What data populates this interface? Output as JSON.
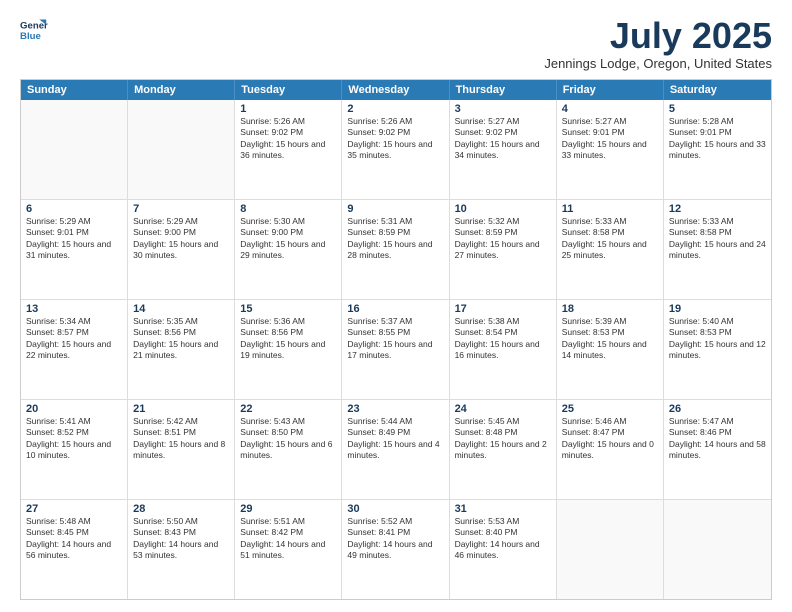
{
  "header": {
    "logo_line1": "General",
    "logo_line2": "Blue",
    "month": "July 2025",
    "location": "Jennings Lodge, Oregon, United States"
  },
  "weekdays": [
    "Sunday",
    "Monday",
    "Tuesday",
    "Wednesday",
    "Thursday",
    "Friday",
    "Saturday"
  ],
  "rows": [
    [
      {
        "day": "",
        "sunrise": "",
        "sunset": "",
        "daylight": ""
      },
      {
        "day": "",
        "sunrise": "",
        "sunset": "",
        "daylight": ""
      },
      {
        "day": "1",
        "sunrise": "Sunrise: 5:26 AM",
        "sunset": "Sunset: 9:02 PM",
        "daylight": "Daylight: 15 hours and 36 minutes."
      },
      {
        "day": "2",
        "sunrise": "Sunrise: 5:26 AM",
        "sunset": "Sunset: 9:02 PM",
        "daylight": "Daylight: 15 hours and 35 minutes."
      },
      {
        "day": "3",
        "sunrise": "Sunrise: 5:27 AM",
        "sunset": "Sunset: 9:02 PM",
        "daylight": "Daylight: 15 hours and 34 minutes."
      },
      {
        "day": "4",
        "sunrise": "Sunrise: 5:27 AM",
        "sunset": "Sunset: 9:01 PM",
        "daylight": "Daylight: 15 hours and 33 minutes."
      },
      {
        "day": "5",
        "sunrise": "Sunrise: 5:28 AM",
        "sunset": "Sunset: 9:01 PM",
        "daylight": "Daylight: 15 hours and 33 minutes."
      }
    ],
    [
      {
        "day": "6",
        "sunrise": "Sunrise: 5:29 AM",
        "sunset": "Sunset: 9:01 PM",
        "daylight": "Daylight: 15 hours and 31 minutes."
      },
      {
        "day": "7",
        "sunrise": "Sunrise: 5:29 AM",
        "sunset": "Sunset: 9:00 PM",
        "daylight": "Daylight: 15 hours and 30 minutes."
      },
      {
        "day": "8",
        "sunrise": "Sunrise: 5:30 AM",
        "sunset": "Sunset: 9:00 PM",
        "daylight": "Daylight: 15 hours and 29 minutes."
      },
      {
        "day": "9",
        "sunrise": "Sunrise: 5:31 AM",
        "sunset": "Sunset: 8:59 PM",
        "daylight": "Daylight: 15 hours and 28 minutes."
      },
      {
        "day": "10",
        "sunrise": "Sunrise: 5:32 AM",
        "sunset": "Sunset: 8:59 PM",
        "daylight": "Daylight: 15 hours and 27 minutes."
      },
      {
        "day": "11",
        "sunrise": "Sunrise: 5:33 AM",
        "sunset": "Sunset: 8:58 PM",
        "daylight": "Daylight: 15 hours and 25 minutes."
      },
      {
        "day": "12",
        "sunrise": "Sunrise: 5:33 AM",
        "sunset": "Sunset: 8:58 PM",
        "daylight": "Daylight: 15 hours and 24 minutes."
      }
    ],
    [
      {
        "day": "13",
        "sunrise": "Sunrise: 5:34 AM",
        "sunset": "Sunset: 8:57 PM",
        "daylight": "Daylight: 15 hours and 22 minutes."
      },
      {
        "day": "14",
        "sunrise": "Sunrise: 5:35 AM",
        "sunset": "Sunset: 8:56 PM",
        "daylight": "Daylight: 15 hours and 21 minutes."
      },
      {
        "day": "15",
        "sunrise": "Sunrise: 5:36 AM",
        "sunset": "Sunset: 8:56 PM",
        "daylight": "Daylight: 15 hours and 19 minutes."
      },
      {
        "day": "16",
        "sunrise": "Sunrise: 5:37 AM",
        "sunset": "Sunset: 8:55 PM",
        "daylight": "Daylight: 15 hours and 17 minutes."
      },
      {
        "day": "17",
        "sunrise": "Sunrise: 5:38 AM",
        "sunset": "Sunset: 8:54 PM",
        "daylight": "Daylight: 15 hours and 16 minutes."
      },
      {
        "day": "18",
        "sunrise": "Sunrise: 5:39 AM",
        "sunset": "Sunset: 8:53 PM",
        "daylight": "Daylight: 15 hours and 14 minutes."
      },
      {
        "day": "19",
        "sunrise": "Sunrise: 5:40 AM",
        "sunset": "Sunset: 8:53 PM",
        "daylight": "Daylight: 15 hours and 12 minutes."
      }
    ],
    [
      {
        "day": "20",
        "sunrise": "Sunrise: 5:41 AM",
        "sunset": "Sunset: 8:52 PM",
        "daylight": "Daylight: 15 hours and 10 minutes."
      },
      {
        "day": "21",
        "sunrise": "Sunrise: 5:42 AM",
        "sunset": "Sunset: 8:51 PM",
        "daylight": "Daylight: 15 hours and 8 minutes."
      },
      {
        "day": "22",
        "sunrise": "Sunrise: 5:43 AM",
        "sunset": "Sunset: 8:50 PM",
        "daylight": "Daylight: 15 hours and 6 minutes."
      },
      {
        "day": "23",
        "sunrise": "Sunrise: 5:44 AM",
        "sunset": "Sunset: 8:49 PM",
        "daylight": "Daylight: 15 hours and 4 minutes."
      },
      {
        "day": "24",
        "sunrise": "Sunrise: 5:45 AM",
        "sunset": "Sunset: 8:48 PM",
        "daylight": "Daylight: 15 hours and 2 minutes."
      },
      {
        "day": "25",
        "sunrise": "Sunrise: 5:46 AM",
        "sunset": "Sunset: 8:47 PM",
        "daylight": "Daylight: 15 hours and 0 minutes."
      },
      {
        "day": "26",
        "sunrise": "Sunrise: 5:47 AM",
        "sunset": "Sunset: 8:46 PM",
        "daylight": "Daylight: 14 hours and 58 minutes."
      }
    ],
    [
      {
        "day": "27",
        "sunrise": "Sunrise: 5:48 AM",
        "sunset": "Sunset: 8:45 PM",
        "daylight": "Daylight: 14 hours and 56 minutes."
      },
      {
        "day": "28",
        "sunrise": "Sunrise: 5:50 AM",
        "sunset": "Sunset: 8:43 PM",
        "daylight": "Daylight: 14 hours and 53 minutes."
      },
      {
        "day": "29",
        "sunrise": "Sunrise: 5:51 AM",
        "sunset": "Sunset: 8:42 PM",
        "daylight": "Daylight: 14 hours and 51 minutes."
      },
      {
        "day": "30",
        "sunrise": "Sunrise: 5:52 AM",
        "sunset": "Sunset: 8:41 PM",
        "daylight": "Daylight: 14 hours and 49 minutes."
      },
      {
        "day": "31",
        "sunrise": "Sunrise: 5:53 AM",
        "sunset": "Sunset: 8:40 PM",
        "daylight": "Daylight: 14 hours and 46 minutes."
      },
      {
        "day": "",
        "sunrise": "",
        "sunset": "",
        "daylight": ""
      },
      {
        "day": "",
        "sunrise": "",
        "sunset": "",
        "daylight": ""
      }
    ]
  ]
}
